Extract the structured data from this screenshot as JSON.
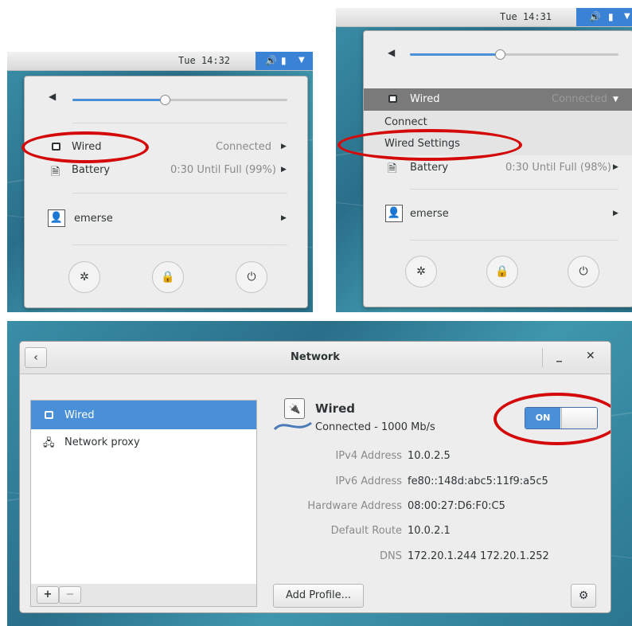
{
  "panel1": {
    "clock": "Tue 14:32",
    "volume_level": 0.4,
    "wired_label": "Wired",
    "wired_status": "Connected",
    "battery_label": "Battery",
    "battery_status": "0:30 Until Full (99%)",
    "user_label": "emerse"
  },
  "panel2": {
    "clock": "Tue 14:31",
    "volume_level": 0.42,
    "wired_label": "Wired",
    "wired_status": "Connected",
    "connect_label": "Connect",
    "wired_settings_label": "Wired Settings",
    "battery_label": "Battery",
    "battery_status": "0:30 Until Full (98%)",
    "user_label": "emerse"
  },
  "network_window": {
    "title": "Network",
    "sidebar_items": [
      {
        "label": "Wired",
        "icon": "wired-icon",
        "selected": true
      },
      {
        "label": "Network proxy",
        "icon": "network-proxy-icon",
        "selected": false
      }
    ],
    "add_label": "+",
    "remove_label": "−",
    "device_name": "Wired",
    "device_status": "Connected - 1000 Mb/s",
    "toggle_label": "ON",
    "details": [
      {
        "label": "IPv4 Address",
        "value": "10.0.2.5"
      },
      {
        "label": "IPv6 Address",
        "value": "fe80::148d:abc5:11f9:a5c5"
      },
      {
        "label": "Hardware Address",
        "value": "08:00:27:D6:F0:C5"
      },
      {
        "label": "Default Route",
        "value": "10.0.2.1"
      },
      {
        "label": "DNS",
        "value": "172.20.1.244 172.20.1.252"
      }
    ],
    "add_profile_label": "Add Profile..."
  },
  "colors": {
    "accent": "#3a82d6",
    "highlight_ellipse": "#d40a0a",
    "selected_row": "#4a90d9"
  }
}
